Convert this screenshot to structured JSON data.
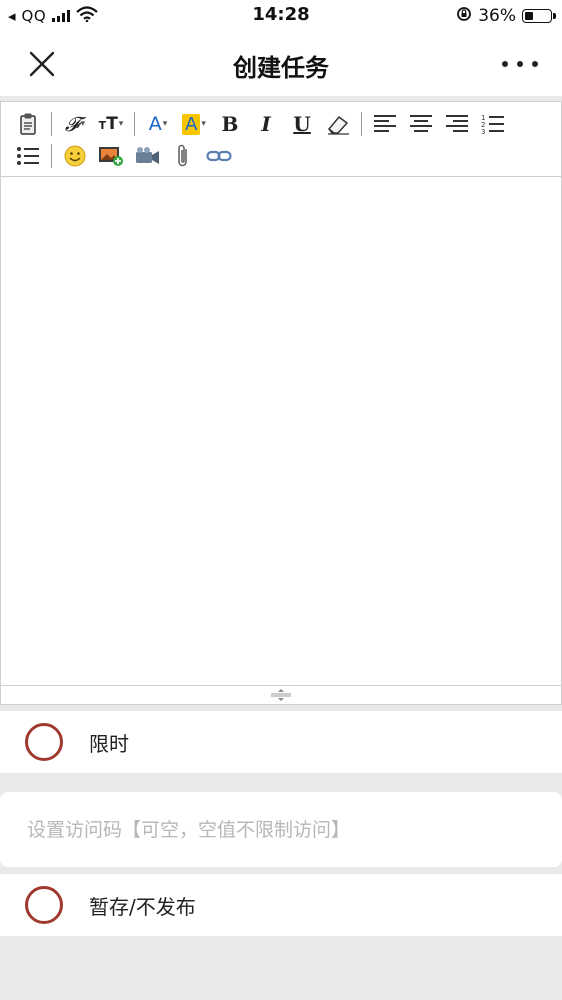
{
  "status_bar": {
    "carrier": "QQ",
    "time": "14:28",
    "battery_percent": "36%",
    "battery_level": 0.36
  },
  "header": {
    "title": "创建任务"
  },
  "editor": {
    "toolbar_row1": [
      "paste-icon",
      "font-family-icon",
      "font-size-icon",
      "font-color-icon",
      "highlight-icon",
      "bold-icon",
      "italic-icon",
      "underline-icon",
      "eraser-icon",
      "align-left-icon",
      "align-center-icon",
      "align-right-icon",
      "ordered-list-icon"
    ],
    "toolbar_row2": [
      "bullet-list-icon",
      "emoji-icon",
      "image-icon",
      "video-icon",
      "attachment-icon",
      "link-icon"
    ],
    "content": ""
  },
  "form": {
    "time_limit_label": "限时",
    "access_code_placeholder": "设置访问码【可空，空值不限制访问】",
    "access_code_value": "",
    "draft_label": "暂存/不发布"
  },
  "colors": {
    "radio_border": "#a0392e",
    "page_background": "#ebe8e8",
    "highlight": "#f7c600",
    "font_color": "#1a64c8"
  }
}
